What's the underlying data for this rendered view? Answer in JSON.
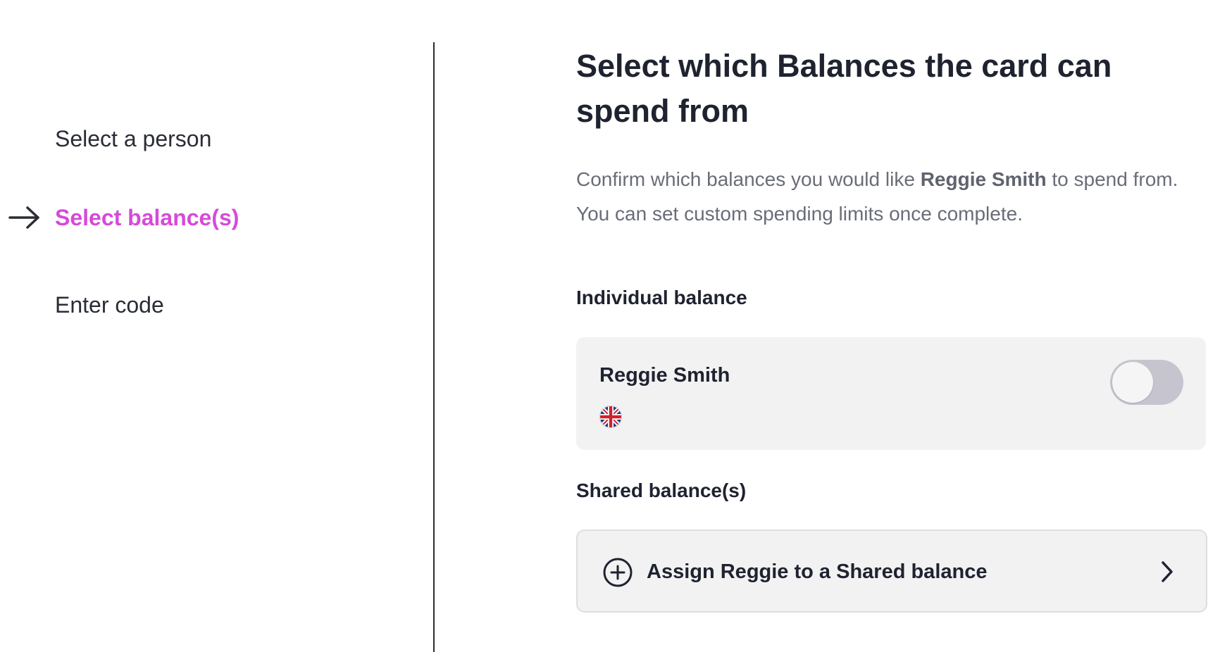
{
  "stepper": {
    "steps": [
      {
        "label": "Select a person",
        "state": "inactive"
      },
      {
        "label": "Select balance(s)",
        "state": "active"
      },
      {
        "label": "Enter code",
        "state": "inactive"
      }
    ],
    "active_color": "#d64ad8",
    "active_indicator_icon": "arrow-right-icon"
  },
  "main": {
    "title": "Select which Balances the card can spend from",
    "description": {
      "prefix": "Confirm which balances you would like ",
      "name": "Reggie Smith",
      "suffix": " to spend from. You can set custom spending limits once complete."
    },
    "individual": {
      "heading": "Individual balance",
      "card": {
        "name": "Reggie Smith",
        "flag_icon": "uk-flag-icon",
        "toggle_on": false
      }
    },
    "shared": {
      "heading": "Shared balance(s)",
      "assign_button": {
        "label": "Assign Reggie to a Shared balance",
        "leading_icon": "plus-circle-icon",
        "trailing_icon": "chevron-right-icon"
      }
    }
  }
}
